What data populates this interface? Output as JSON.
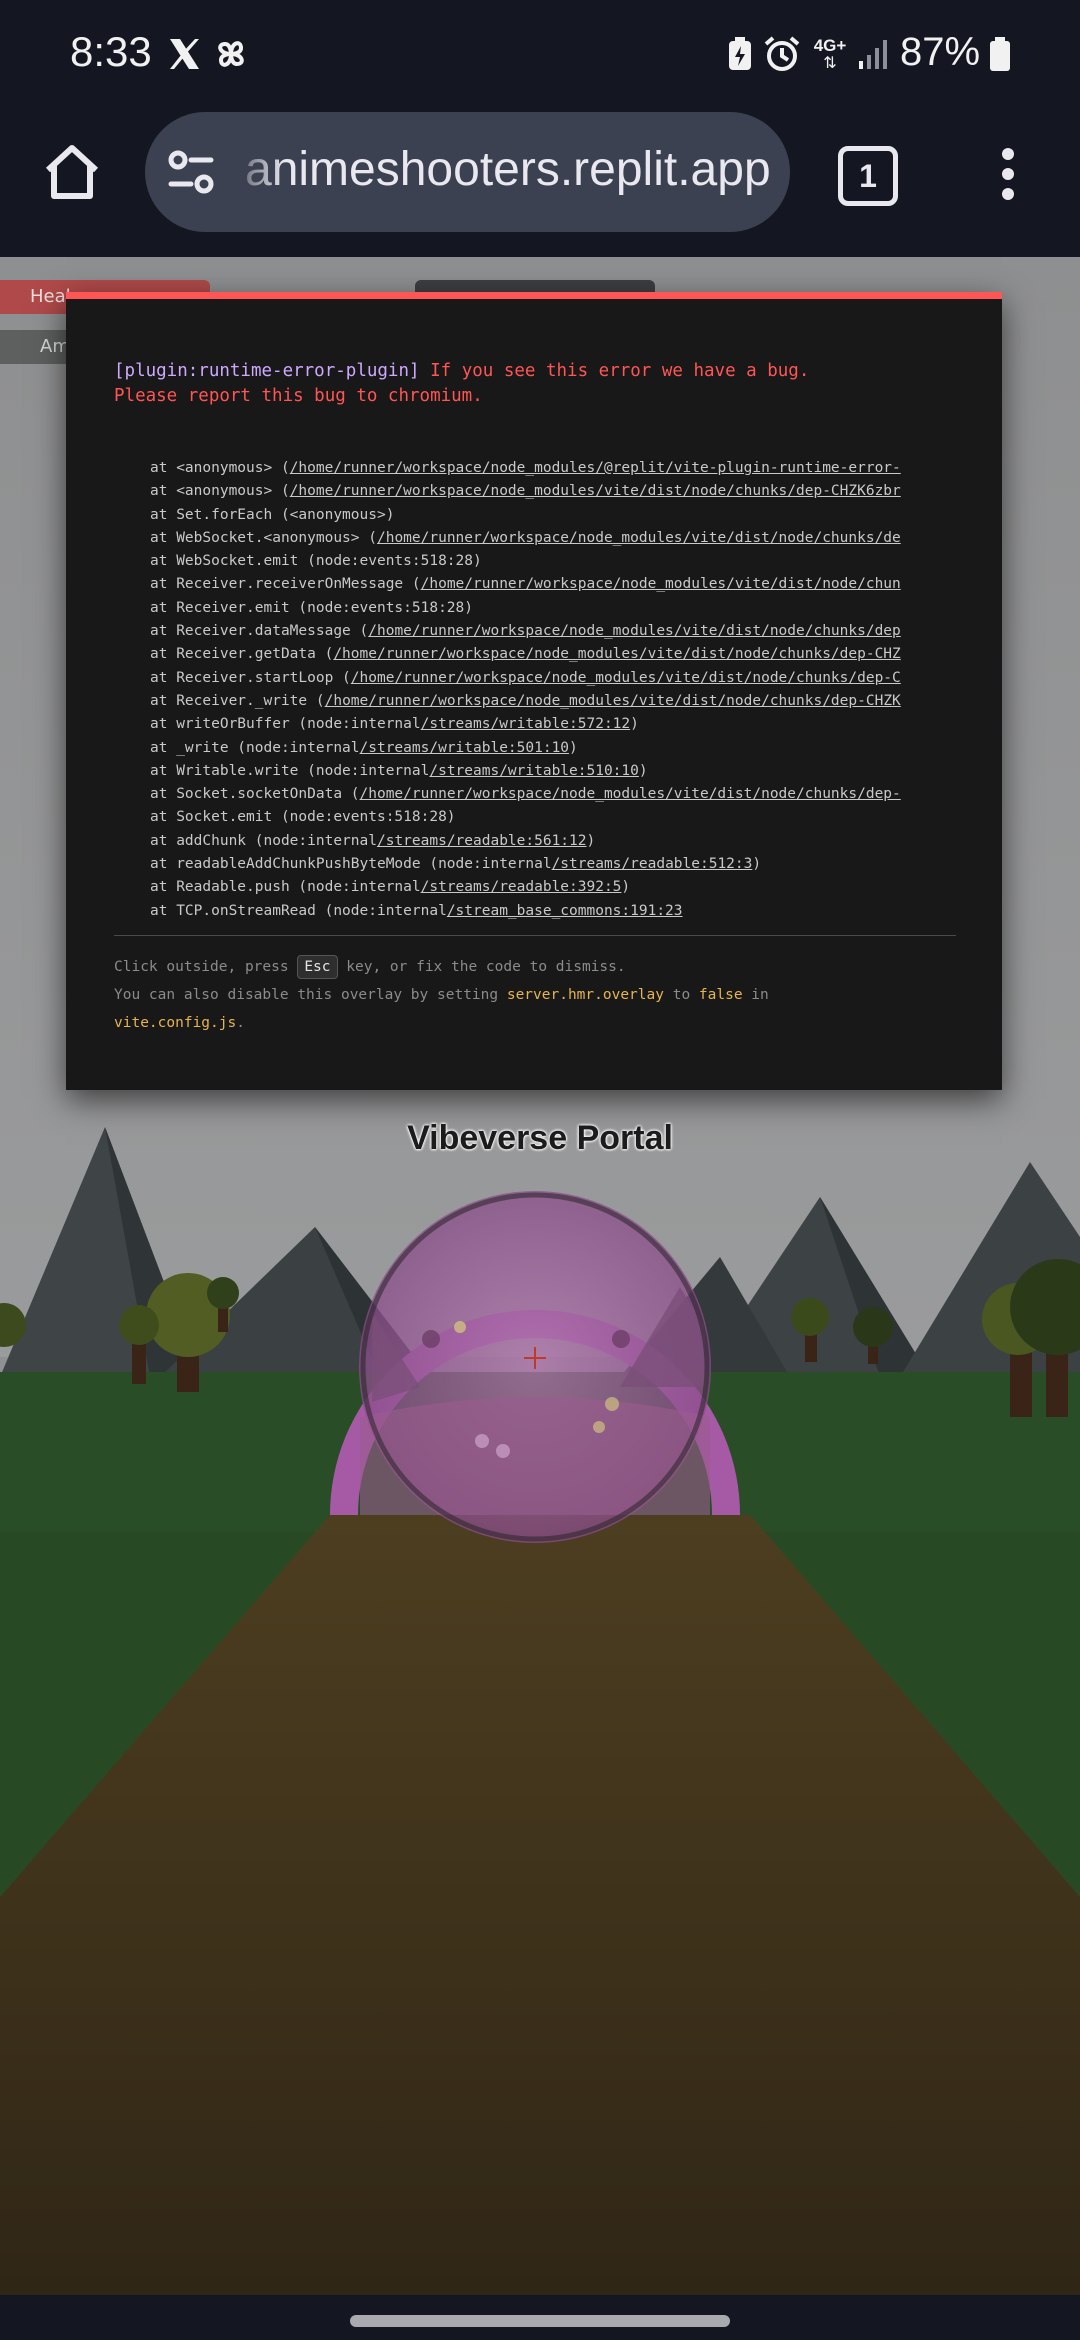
{
  "status_bar": {
    "time": "8:33",
    "network": "4G+",
    "battery": "87%",
    "icons": [
      "x-app-icon",
      "pinwheel-app-icon",
      "battery-saver-icon",
      "alarm-icon",
      "network-arrows-icon",
      "signal-icon",
      "battery-icon"
    ]
  },
  "browser": {
    "url": "animeshooters.replit.app",
    "tab_count": "1",
    "icons": [
      "home-icon",
      "site-settings-icon",
      "tabs-icon",
      "more-vert-icon"
    ]
  },
  "game": {
    "hud_health": "Heal",
    "hud_ammo": "Am",
    "portal_title": "Vibeverse Portal"
  },
  "error_overlay": {
    "plugin": "[plugin:runtime-error-plugin]",
    "message_line1": " If you see this error we have a bug.",
    "message_line2": "Please report this bug to chromium.",
    "stack": [
      {
        "prefix": "at <anonymous> (",
        "path": "/home/runner/workspace/node_modules/@replit/vite-plugin-runtime-error-"
      },
      {
        "prefix": "at <anonymous> (",
        "path": "/home/runner/workspace/node_modules/vite/dist/node/chunks/dep-CHZK6zbr"
      },
      {
        "prefix": "at Set.forEach (<anonymous>)",
        "path": ""
      },
      {
        "prefix": "at WebSocket.<anonymous> (",
        "path": "/home/runner/workspace/node_modules/vite/dist/node/chunks/de"
      },
      {
        "prefix": "at WebSocket.emit (node:events:518:28)",
        "path": ""
      },
      {
        "prefix": "at Receiver.receiverOnMessage (",
        "path": "/home/runner/workspace/node_modules/vite/dist/node/chun"
      },
      {
        "prefix": "at Receiver.emit (node:events:518:28)",
        "path": ""
      },
      {
        "prefix": "at Receiver.dataMessage (",
        "path": "/home/runner/workspace/node_modules/vite/dist/node/chunks/dep"
      },
      {
        "prefix": "at Receiver.getData (",
        "path": "/home/runner/workspace/node_modules/vite/dist/node/chunks/dep-CHZ"
      },
      {
        "prefix": "at Receiver.startLoop (",
        "path": "/home/runner/workspace/node_modules/vite/dist/node/chunks/dep-C"
      },
      {
        "prefix": "at Receiver._write (",
        "path": "/home/runner/workspace/node_modules/vite/dist/node/chunks/dep-CHZK"
      },
      {
        "prefix": "at writeOrBuffer (node:internal",
        "path": "/streams/writable:572:12",
        "suffix": ")"
      },
      {
        "prefix": "at _write (node:internal",
        "path": "/streams/writable:501:10",
        "suffix": ")"
      },
      {
        "prefix": "at Writable.write (node:internal",
        "path": "/streams/writable:510:10",
        "suffix": ")"
      },
      {
        "prefix": "at Socket.socketOnData (",
        "path": "/home/runner/workspace/node_modules/vite/dist/node/chunks/dep-"
      },
      {
        "prefix": "at Socket.emit (node:events:518:28)",
        "path": ""
      },
      {
        "prefix": "at addChunk (node:internal",
        "path": "/streams/readable:561:12",
        "suffix": ")"
      },
      {
        "prefix": "at readableAddChunkPushByteMode (node:internal",
        "path": "/streams/readable:512:3",
        "suffix": ")"
      },
      {
        "prefix": "at Readable.push (node:internal",
        "path": "/streams/readable:392:5",
        "suffix": ")"
      },
      {
        "prefix": "at TCP.onStreamRead (node:internal",
        "path": "/stream_base_commons:191:23",
        "suffix": ""
      }
    ],
    "tip_1a": "Click outside, press ",
    "tip_key": "Esc",
    "tip_1b": " key, or fix the code to dismiss.",
    "tip_2a": "You can also disable this overlay by setting ",
    "tip_2_setting": "server.hmr.overlay",
    "tip_2b": " to ",
    "tip_2_value": "false",
    "tip_2c": " in",
    "tip_3_file": "vite.config.js",
    "tip_3b": "."
  },
  "colors": {
    "error_accent": "#ff5555",
    "plugin_name": "#cfa8ff",
    "highlight": "#e6b450",
    "portal_ring": "#a65aa6",
    "path": "#3a2d1a",
    "grass": "#274a25"
  }
}
